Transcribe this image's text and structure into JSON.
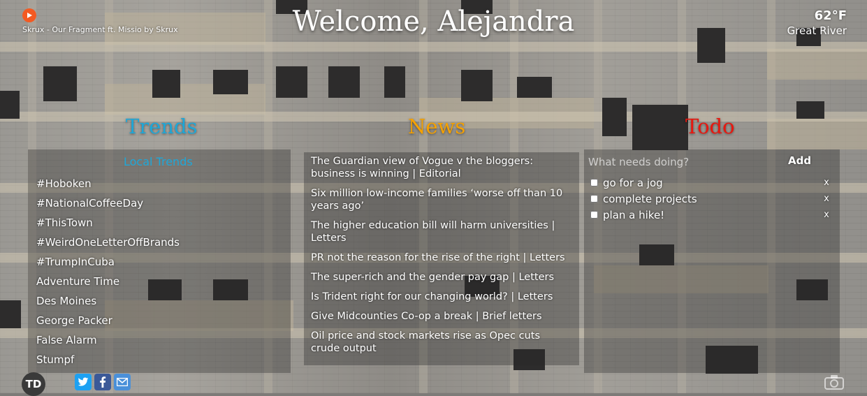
{
  "music": {
    "track": "Skrux - Our Fragment ft. Missio by Skrux",
    "play_icon": "play-icon"
  },
  "welcome": "Welcome, Alejandra",
  "weather": {
    "temp": "62°F",
    "city": "Great River"
  },
  "sections": {
    "trends": {
      "title": "Trends",
      "color": "#1ea7d8"
    },
    "news": {
      "title": "News",
      "color": "#f5a100"
    },
    "todo": {
      "title": "Todo",
      "color": "#e8170f"
    }
  },
  "trends": {
    "subtitle": "Local Trends",
    "items": [
      "#Hoboken",
      "#NationalCoffeeDay",
      "#ThisTown",
      "#WeirdOneLetterOffBrands",
      "#TrumpInCuba",
      "Adventure Time",
      "Des Moines",
      "George Packer",
      "False Alarm",
      "Stumpf"
    ]
  },
  "news": {
    "items": [
      "The Guardian view of Vogue v the bloggers: business is winning | Editorial",
      "Six million low-income families ‘worse off than 10 years ago’",
      "The higher education bill will harm universities | Letters",
      "PR not the reason for the rise of the right | Letters",
      "The super-rich and the gender pay gap | Letters",
      "Is Trident right for our changing world? | Letters",
      "Give Midcounties Co-op a break | Brief letters",
      "Oil price and stock markets rise as Opec cuts crude output"
    ]
  },
  "todo": {
    "placeholder": "What needs doing?",
    "add_label": "Add",
    "delete_label": "x",
    "items": [
      "go for a jog",
      "complete projects",
      "plan a hike!"
    ]
  },
  "footer": {
    "logo": "TD",
    "social_icons": [
      "twitter-icon",
      "facebook-icon",
      "email-icon"
    ],
    "camera_icon": "camera-icon"
  }
}
